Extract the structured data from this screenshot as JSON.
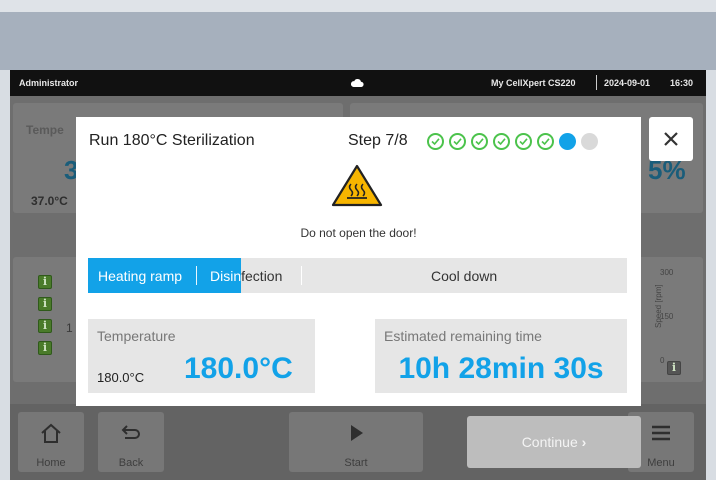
{
  "status_bar": {
    "user": "Administrator",
    "cloud_icon": "cloud-icon",
    "device_name": "My CellXpert CS220",
    "date": "2024-09-01",
    "time": "16:30"
  },
  "background": {
    "card1_label": "Tempe",
    "card1_big": "3",
    "card1_sub": "37.0°C",
    "card2_big": "5%",
    "row_value": "1",
    "right_axis_top": "300",
    "right_axis_mid": "150",
    "right_axis_low": "0",
    "right_axis_label": "Speed [rpm]"
  },
  "dialog": {
    "title": "Run 180°C Sterilization",
    "step_label": "Step 7/8",
    "steps": [
      "done",
      "done",
      "done",
      "done",
      "done",
      "done",
      "current",
      "pending"
    ],
    "warning_icon": "hot-surface-warning-icon",
    "warning_text": "Do not open the door!",
    "phases": [
      {
        "label": "Heating ramp",
        "state": "complete"
      },
      {
        "label": "Disinfection",
        "state": "partial",
        "progress": 0.3
      },
      {
        "label": "Cool down",
        "state": "pending"
      }
    ],
    "temperature": {
      "label": "Temperature",
      "setpoint": "180.0°C",
      "value": "180.0°C"
    },
    "remaining": {
      "label": "Estimated remaining time",
      "value": "10h 28min 30s"
    },
    "close_icon": "close-icon"
  },
  "bottom_nav": {
    "home": "Home",
    "back": "Back",
    "start": "Start",
    "menu": "Menu",
    "continue": "Continue"
  },
  "colors": {
    "accent_blue": "#12a2e8",
    "step_done_green": "#4cc34c",
    "warning_yellow": "#f7b500"
  }
}
